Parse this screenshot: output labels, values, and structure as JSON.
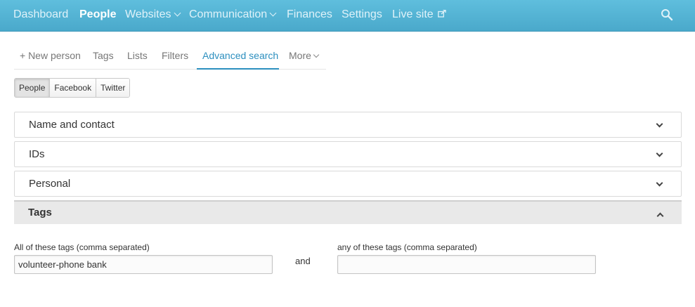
{
  "topnav": {
    "items": [
      {
        "label": "Dashboard",
        "active": false
      },
      {
        "label": "People",
        "active": true
      },
      {
        "label": "Websites",
        "active": false,
        "dropdown": true
      },
      {
        "label": "Communication",
        "active": false,
        "dropdown": true
      },
      {
        "label": "Finances",
        "active": false
      },
      {
        "label": "Settings",
        "active": false
      },
      {
        "label": "Live site",
        "active": false,
        "external": true
      }
    ],
    "search_icon": "search-icon",
    "colors": {
      "bar": "#4fb0d2",
      "text": "#dff2f9",
      "active_text": "#ffffff"
    }
  },
  "subtabs": {
    "items": [
      {
        "label": "+ New person"
      },
      {
        "label": "Tags"
      },
      {
        "label": "Lists"
      },
      {
        "label": "Filters"
      },
      {
        "label": "Advanced search",
        "active": true
      },
      {
        "label": "More",
        "dropdown": true
      }
    ],
    "active_color": "#2c8fbf"
  },
  "segments": {
    "items": [
      {
        "label": "People",
        "active": true
      },
      {
        "label": "Facebook"
      },
      {
        "label": "Twitter"
      }
    ]
  },
  "accordion": {
    "panels": [
      {
        "title": "Name and contact",
        "state": "collapsed"
      },
      {
        "title": "IDs",
        "state": "collapsed"
      },
      {
        "title": "Personal",
        "state": "collapsed"
      },
      {
        "title": "Tags",
        "state": "expanded"
      }
    ]
  },
  "tags_form": {
    "all_label": "All of these tags (comma separated)",
    "all_value": "volunteer-phone bank",
    "and_text": "and",
    "any_label": "any of these tags (comma separated)",
    "any_value": ""
  }
}
